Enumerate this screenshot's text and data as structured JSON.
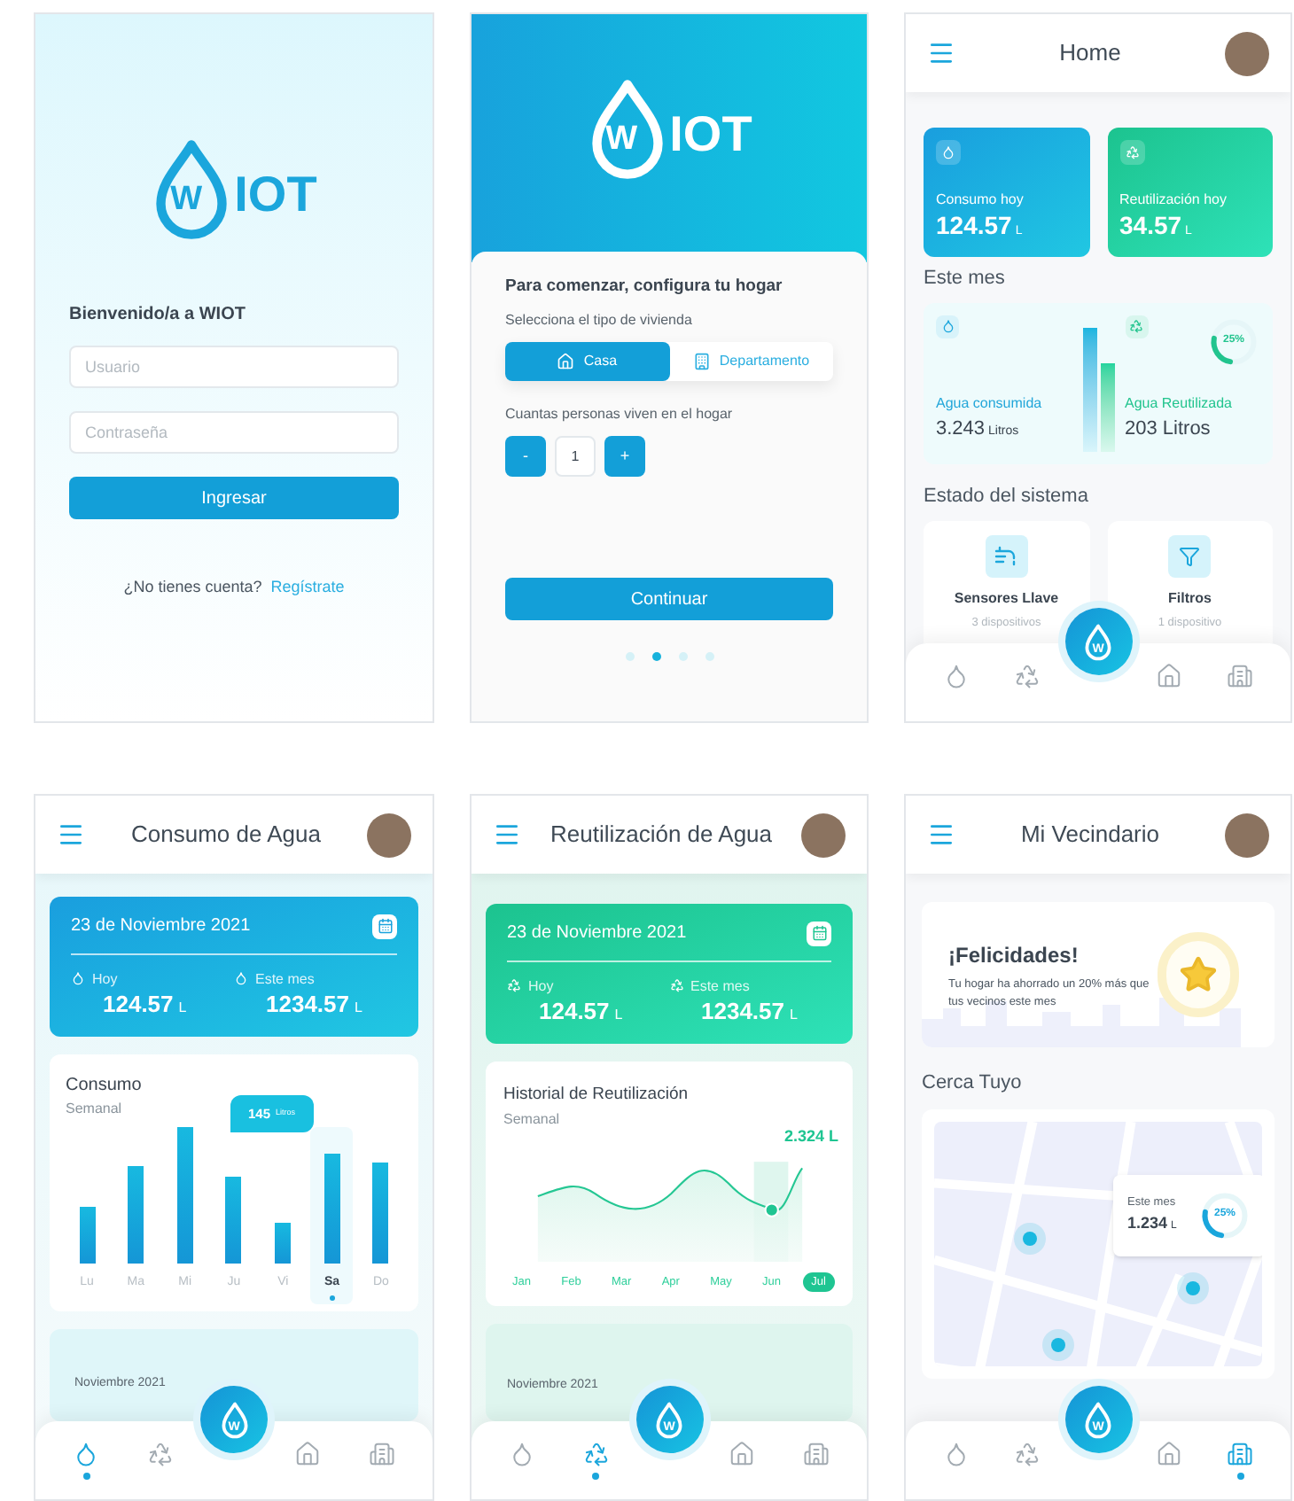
{
  "screens": [
    {
      "kind": "login",
      "logo": {
        "mark": "W",
        "text": "IOT"
      },
      "welcome": "Bienvenido/a a WIOT",
      "fields": [
        {
          "placeholder": "Usuario"
        },
        {
          "placeholder": "Contraseña"
        }
      ],
      "submit": "Ingresar",
      "signup_prompt": "¿No tienes cuenta?",
      "signup_link": "Regístrate"
    },
    {
      "kind": "setup",
      "logo": {
        "mark": "W",
        "text": "IOT"
      },
      "heading": "Para comenzar, configura tu hogar",
      "housing_label": "Selecciona el tipo de vivienda",
      "housing_options": [
        {
          "kind": "house",
          "label": "Casa",
          "selected": true
        },
        {
          "kind": "apartment",
          "label": "Departamento",
          "selected": false
        }
      ],
      "people_label": "Cuantas personas viven en el hogar",
      "stepper": {
        "decrement": "-",
        "value": "1",
        "increment": "+"
      },
      "continue": "Continuar",
      "pager": [
        {
          "selected": false
        },
        {
          "selected": true
        },
        {
          "selected": false
        },
        {
          "selected": false
        }
      ]
    },
    {
      "kind": "home",
      "header": {
        "title": "Home"
      },
      "today": [
        {
          "kind": "consumption",
          "label": "Consumo hoy",
          "value": "124.57",
          "unit": "L"
        },
        {
          "kind": "reuse",
          "label": "Reutilización hoy",
          "value": "34.57",
          "unit": "L"
        }
      ],
      "month_title": "Este mes",
      "month": {
        "consumed": {
          "label": "Agua consumida",
          "value": "3.243",
          "unit": "Litros"
        },
        "reused": {
          "label": "Agua Reutilizada",
          "value": "203 Litros"
        },
        "ring": {
          "label": "25%",
          "level": 0.25
        }
      },
      "system_title": "Estado del sistema",
      "devices": [
        {
          "kind": "faucet",
          "name": "Sensores Llave",
          "count": "3 dispositivos"
        },
        {
          "kind": "filter",
          "name": "Filtros",
          "count": "1 dispositivo"
        }
      ],
      "nav": {
        "fab_mark": "W",
        "items": [
          {
            "kind": "drop",
            "selected": false
          },
          {
            "kind": "recycle",
            "selected": false
          },
          {
            "kind": "house",
            "selected": false
          },
          {
            "kind": "buildings",
            "selected": false
          }
        ]
      }
    },
    {
      "kind": "consumption",
      "header": {
        "title": "Consumo de Agua"
      },
      "summary": {
        "date": "23 de Noviembre 2021",
        "stats": [
          {
            "label": "Hoy",
            "value": "124.57",
            "unit": "L"
          },
          {
            "label": "Este mes",
            "value": "1234.57",
            "unit": "L"
          }
        ]
      },
      "chart": {
        "title": "Consumo",
        "subtitle": "Semanal",
        "tooltip": {
          "value": "145",
          "unit": "Litros"
        },
        "days": [
          {
            "label": "Lu",
            "selected": false
          },
          {
            "label": "Ma",
            "selected": false
          },
          {
            "label": "Mi",
            "selected": false
          },
          {
            "label": "Ju",
            "selected": false
          },
          {
            "label": "Vi",
            "selected": false
          },
          {
            "label": "Sa",
            "selected": true
          },
          {
            "label": "Do",
            "selected": false
          }
        ]
      },
      "next_card": {
        "title": "Noviembre 2021"
      },
      "nav": {
        "fab_mark": "W",
        "items": [
          {
            "kind": "drop",
            "selected": true
          },
          {
            "kind": "recycle",
            "selected": false
          },
          {
            "kind": "house",
            "selected": false
          },
          {
            "kind": "buildings",
            "selected": false
          }
        ]
      }
    },
    {
      "kind": "reuse",
      "header": {
        "title": "Reutilización de Agua"
      },
      "summary": {
        "date": "23 de Noviembre 2021",
        "stats": [
          {
            "label": "Hoy",
            "value": "124.57",
            "unit": "L"
          },
          {
            "label": "Este mes",
            "value": "1234.57",
            "unit": "L"
          }
        ]
      },
      "chart": {
        "title": "Historial de Reutilización",
        "subtitle": "Semanal",
        "point_label": "2.324 L",
        "months": [
          {
            "label": "Jan",
            "selected": false
          },
          {
            "label": "Feb",
            "selected": false
          },
          {
            "label": "Mar",
            "selected": false
          },
          {
            "label": "Apr",
            "selected": false
          },
          {
            "label": "May",
            "selected": false
          },
          {
            "label": "Jun",
            "selected": false
          },
          {
            "label": "Jul",
            "selected": true
          }
        ]
      },
      "next_card": {
        "title": "Noviembre 2021"
      },
      "nav": {
        "fab_mark": "W",
        "items": [
          {
            "kind": "drop",
            "selected": false
          },
          {
            "kind": "recycle",
            "selected": true
          },
          {
            "kind": "house",
            "selected": false
          },
          {
            "kind": "buildings",
            "selected": false
          }
        ]
      }
    },
    {
      "kind": "neighborhood",
      "header": {
        "title": "Mi Vecindario"
      },
      "congrats": {
        "title": "¡Felicidades!",
        "text": "Tu hogar ha ahorrado un 20% más que tus vecinos este mes"
      },
      "nearby_title": "Cerca Tuyo",
      "map_popup": {
        "label": "Este mes",
        "value": "1.234",
        "unit": "L",
        "ring": {
          "label": "25%",
          "level": 0.25
        }
      },
      "nav": {
        "fab_mark": "W",
        "items": [
          {
            "kind": "drop",
            "selected": false
          },
          {
            "kind": "recycle",
            "selected": false
          },
          {
            "kind": "house",
            "selected": false
          },
          {
            "kind": "buildings",
            "selected": true
          }
        ]
      }
    }
  ]
}
